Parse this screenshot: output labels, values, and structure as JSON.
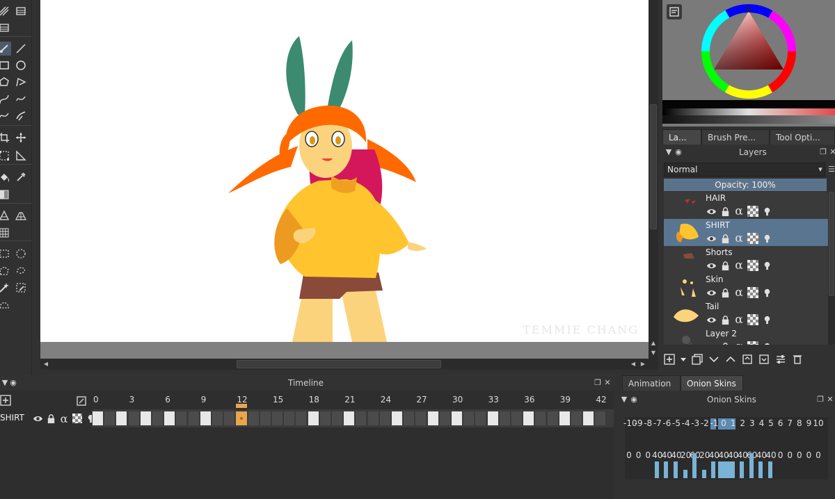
{
  "toolbox": {
    "tools": [
      "multibrush-icon",
      "smart-patch-icon",
      "freehand-brush-icon",
      "line-icon",
      "rectangle-icon",
      "ellipse-icon",
      "polygon-icon",
      "polyline-icon",
      "bezier-icon",
      "freehand-path-icon",
      "dynamic-brush-icon",
      "multibrush-icon",
      "crop-icon",
      "move-icon",
      "transform-icon",
      "measure-icon",
      "fill-icon",
      "color-picker-icon",
      "gradient-icon",
      "assistant-icon",
      "perspective-grid-icon",
      "grid-icon",
      "rect-select-icon",
      "ellipse-select-icon",
      "polygon-select-icon",
      "freehand-select-icon",
      "magic-wand-icon",
      "similar-select-icon",
      "bezier-select-icon"
    ]
  },
  "canvas": {
    "watermark": "TEMMIE CHANG"
  },
  "right_dock": {
    "tabs": [
      {
        "label": "La...",
        "active": true
      },
      {
        "label": "Brush Pre...",
        "active": false
      },
      {
        "label": "Tool Opti...",
        "active": false
      }
    ],
    "layers_title": "Layers",
    "blend_mode": "Normal",
    "opacity_label": "Opacity:  100%",
    "layers": [
      {
        "name": "HAIR",
        "selected": false
      },
      {
        "name": "SHIRT",
        "selected": true
      },
      {
        "name": "Shorts",
        "selected": false
      },
      {
        "name": "Skin",
        "selected": false
      },
      {
        "name": "Tail",
        "selected": false
      },
      {
        "name": "Layer 2",
        "selected": false
      }
    ]
  },
  "timeline": {
    "title": "Timeline",
    "frame_numbers": [
      "0",
      "3",
      "6",
      "9",
      "12",
      "15",
      "18",
      "21",
      "24",
      "27",
      "30",
      "33",
      "36",
      "39",
      "42"
    ],
    "layer_name": "SHIRT",
    "keyframes": [
      0,
      2,
      4,
      6,
      9,
      18,
      21,
      25,
      28,
      30,
      33,
      36,
      39,
      41
    ],
    "current_frame": 12
  },
  "onion": {
    "tabs": [
      {
        "label": "Animation",
        "active": false
      },
      {
        "label": "Onion Skins",
        "active": true
      }
    ],
    "title": "Onion Skins",
    "offsets": [
      "-10",
      "-9",
      "-8",
      "-7",
      "-6",
      "-5",
      "-4",
      "-3",
      "-2",
      "-1",
      "0",
      "1",
      "2",
      "3",
      "4",
      "5",
      "6",
      "7",
      "8",
      "9",
      "10"
    ],
    "opacity_values": [
      "0",
      "0",
      "0",
      "40",
      "40",
      "40",
      "20",
      "60",
      "20",
      "40",
      "40",
      "40",
      "40",
      "60",
      "40",
      "40",
      "0",
      "0",
      "0",
      "0",
      "0"
    ],
    "bar_levels": [
      0,
      0,
      0,
      0.4,
      0.4,
      0.4,
      0.2,
      0.6,
      0.2,
      0.4,
      0.4,
      0.4,
      0.4,
      0.6,
      0.4,
      0.4,
      0,
      0,
      0,
      0,
      0
    ]
  },
  "colors": {
    "accent": "#5b738a",
    "playhead": "#e8a64e",
    "onion_bar": "#79b3d6"
  }
}
